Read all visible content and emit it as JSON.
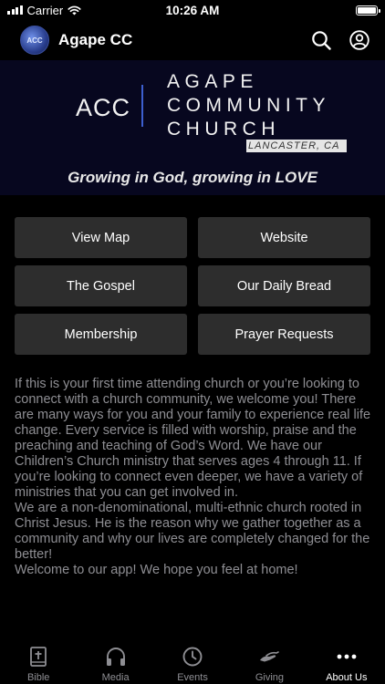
{
  "status_bar": {
    "carrier": "Carrier",
    "time": "10:26 AM"
  },
  "nav": {
    "title": "Agape CC",
    "avatar_text": "ACC"
  },
  "banner": {
    "acc": "ACC",
    "name_lines": [
      "AGAPE",
      "COMMUNITY",
      "CHURCH"
    ],
    "place": "LANCASTER, CA",
    "slogan": "Growing in God, growing in LOVE"
  },
  "buttons": [
    {
      "label": "View Map",
      "name": "view-map-button"
    },
    {
      "label": "Website",
      "name": "website-button"
    },
    {
      "label": "The Gospel",
      "name": "the-gospel-button"
    },
    {
      "label": "Our Daily Bread",
      "name": "our-daily-bread-button"
    },
    {
      "label": "Membership",
      "name": "membership-button"
    },
    {
      "label": "Prayer Requests",
      "name": "prayer-requests-button"
    }
  ],
  "intro": [
    "If this is your first time attending church or you’re looking to connect with a church community, we welcome you! There are many ways for you and your family to experience real life change. Every service is filled with worship, praise and the preaching and teaching of God’s Word. We have our Children’s Church ministry that serves ages 4 through 11. If you’re looking to connect even deeper, we have a variety of ministries that you can get involved in.",
    "We are a non-denominational, multi-ethnic church rooted in Christ Jesus. He is the reason why we gather together as a community and why our lives are completely changed for the better!",
    "Welcome to our app! We hope you feel at home!"
  ],
  "tabs": [
    {
      "label": "Bible",
      "icon": "bible-icon"
    },
    {
      "label": "Media",
      "icon": "headphones-icon"
    },
    {
      "label": "Events",
      "icon": "clock-icon"
    },
    {
      "label": "Giving",
      "icon": "giving-hand-icon"
    },
    {
      "label": "About Us",
      "icon": "more-icon",
      "active": true
    }
  ],
  "colors": {
    "background": "#000000",
    "button": "#2d2d2d",
    "muted_text": "#8e8e93",
    "accent_divider": "#3d5fd0"
  }
}
